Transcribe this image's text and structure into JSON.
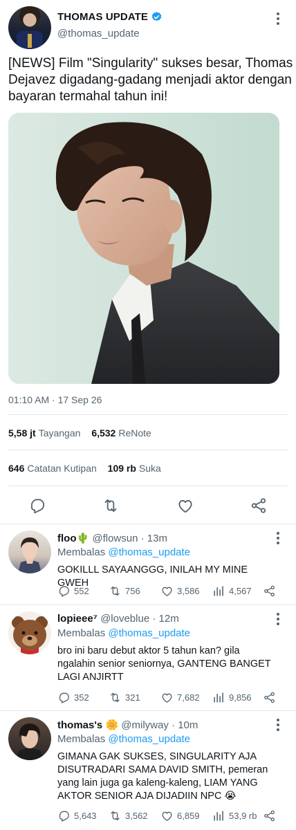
{
  "main_tweet": {
    "display_name": "THOMAS UPDATE",
    "handle": "@thomas_update",
    "text": "[NEWS] Film \"Singularity\" sukses besar, Thomas Dejavez digadang-gadang menjadi aktor dengan bayaran termahal tahun ini!",
    "timestamp": "01:10 AM · 17 Sep 26",
    "stats_row1": [
      {
        "value": "5,58 jt",
        "label": "Tayangan"
      },
      {
        "value": "6,532",
        "label": "ReNote"
      }
    ],
    "stats_row2": [
      {
        "value": "646",
        "label": "Catatan Kutipan"
      },
      {
        "value": "109 rb",
        "label": "Suka"
      }
    ],
    "actions": [
      "reply-icon",
      "renote-icon",
      "like-icon",
      "share-icon"
    ]
  },
  "replies": [
    {
      "display_name": "floo",
      "name_emoji": "🌵",
      "handle": "@flowsun",
      "time": "13m",
      "replying_prefix": "Membalas",
      "replying_to": "@thomas_update",
      "text": "GOKILLL SAYAANGGG, INILAH MY MINE GWEH",
      "replies": "552",
      "renotes": "756",
      "likes": "3,586",
      "views": "4,567"
    },
    {
      "display_name": "lopieee⁷",
      "name_emoji": "",
      "handle": "@loveblue",
      "time": "12m",
      "replying_prefix": "Membalas",
      "replying_to": "@thomas_update",
      "text": "bro ini baru debut aktor 5 tahun kan? gila ngalahin senior seniornya, GANTENG BANGET LAGI ANJIRTT",
      "replies": "352",
      "renotes": "321",
      "likes": "7,682",
      "views": "9,856"
    },
    {
      "display_name": "thomas's",
      "name_emoji": "🌼",
      "handle": "@milyway",
      "time": "10m",
      "replying_prefix": "Membalas",
      "replying_to": "@thomas_update",
      "text": "GIMANA GAK SUKSES, SINGULARITY AJA DISUTRADARI SAMA DAVID SMITH, pemeran yang lain juga ga kaleng-kaleng, LIAM YANG AKTOR SENIOR AJA DIJADIIN NPC 😭",
      "replies": "5,643",
      "renotes": "3,562",
      "likes": "6,859",
      "views": "53,9 rb"
    }
  ],
  "colors": {
    "text": "#0f1419",
    "secondary": "#536471",
    "accent": "#1d9bf0",
    "divider": "#e1e6ea"
  }
}
